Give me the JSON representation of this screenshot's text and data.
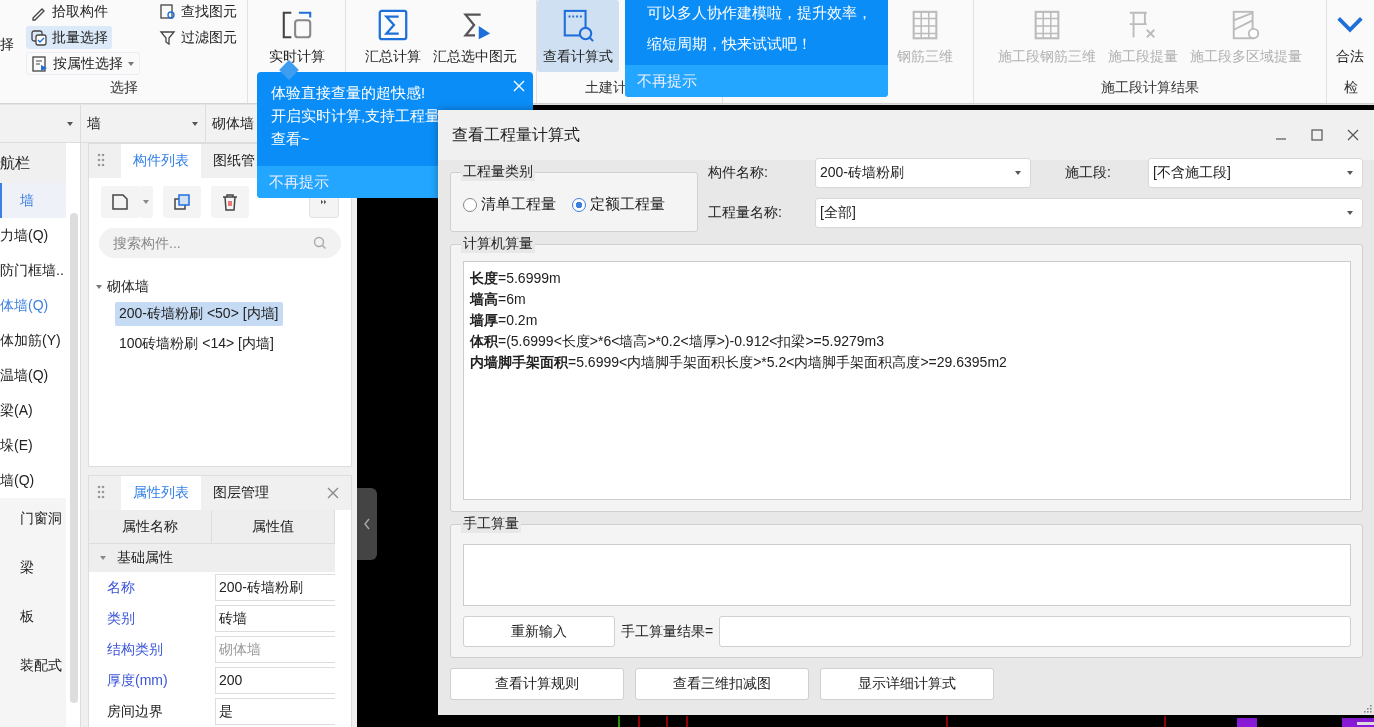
{
  "ribbon": {
    "partial_text": "择",
    "select_group": {
      "label": "选择",
      "columns": [
        [
          {
            "kind": "pick",
            "label": "拾取构件",
            "selected": false,
            "dropdown": false
          },
          {
            "kind": "batch",
            "label": "批量选择",
            "selected": true,
            "dropdown": false
          },
          {
            "kind": "attr",
            "label": "按属性选择",
            "selected": false,
            "dropdown": true
          }
        ],
        [
          {
            "kind": "find",
            "label": "查找图元",
            "selected": false,
            "dropdown": false
          },
          {
            "kind": "filter",
            "label": "过滤图元",
            "selected": false,
            "dropdown": false
          }
        ]
      ]
    },
    "groups": [
      {
        "buttons": [
          {
            "kind": "realtime",
            "label": "实时计算",
            "selected": false,
            "disabled": false
          }
        ]
      },
      {
        "buttons": [
          {
            "kind": "sum",
            "label": "汇总计算",
            "selected": false,
            "disabled": false
          },
          {
            "kind": "sumsel",
            "label": "汇总选中图元",
            "selected": false,
            "disabled": false
          }
        ]
      },
      {
        "label": "土建计",
        "buttons": [
          {
            "kind": "formula",
            "label": "查看计算式",
            "selected": true,
            "disabled": false
          }
        ]
      },
      {
        "buttons": [
          {
            "kind": "rebar",
            "label": "钢筋三维",
            "selected": false,
            "disabled": true
          }
        ]
      },
      {
        "label": "施工段计算结果",
        "buttons": [
          {
            "kind": "rebar",
            "label": "施工段钢筋三维",
            "selected": false,
            "disabled": true
          },
          {
            "kind": "fx",
            "label": "施工段提量",
            "selected": false,
            "disabled": true
          },
          {
            "kind": "zone",
            "label": "施工段多区域提量",
            "selected": false,
            "disabled": true
          }
        ]
      },
      {
        "label": "检",
        "buttons": [
          {
            "kind": "check",
            "label": "合法",
            "selected": false,
            "disabled": false
          }
        ]
      }
    ]
  },
  "tooltips": [
    {
      "lines": [
        "可以多人协作建模啦，提升效率，",
        "缩短周期，快来试试吧！"
      ],
      "dismiss": "不再提示",
      "closable": false
    },
    {
      "lines": [
        "体验直接查量的超快感!",
        "开启实时计算,支持工程量",
        "查看~"
      ],
      "dismiss": "不再提示",
      "closable": true
    }
  ],
  "filters": [
    {
      "value": "墙"
    },
    {
      "value": "砌体墙"
    }
  ],
  "nav": {
    "header": "航栏",
    "items": [
      {
        "label": "墙",
        "selected": true,
        "emphasized": true
      },
      {
        "label": "力墙(Q)",
        "selected": false,
        "emphasized": false
      },
      {
        "label": "防门框墙..",
        "selected": false,
        "emphasized": false
      },
      {
        "label": "体墙(Q)",
        "selected": false,
        "emphasized": true
      },
      {
        "label": "体加筋(Y)",
        "selected": false,
        "emphasized": false
      },
      {
        "label": "温墙(Q)",
        "selected": false,
        "emphasized": false
      },
      {
        "label": "梁(A)",
        "selected": false,
        "emphasized": false
      },
      {
        "label": "垛(E)",
        "selected": false,
        "emphasized": false
      },
      {
        "label": "墙(Q)",
        "selected": false,
        "emphasized": false
      }
    ],
    "categories": [
      {
        "label": "门窗洞"
      },
      {
        "label": "梁"
      },
      {
        "label": "板"
      },
      {
        "label": "装配式"
      }
    ]
  },
  "component_panel": {
    "tabs": [
      {
        "label": "构件列表",
        "selected": true
      },
      {
        "label": "图纸管",
        "selected": false
      }
    ],
    "search": {
      "placeholder": "搜索构件..."
    },
    "tree": [
      {
        "label": "砌体墙",
        "expanded": true,
        "children": [
          {
            "label": "200-砖墙粉刷 <50> [内墙]",
            "selected": true
          },
          {
            "label": "100砖墙粉刷 <14> [内墙]",
            "selected": false
          }
        ]
      }
    ]
  },
  "property_panel": {
    "tabs": [
      {
        "label": "属性列表",
        "selected": true
      },
      {
        "label": "图层管理",
        "selected": false
      }
    ],
    "columns": [
      "属性名称",
      "属性值"
    ],
    "groups": [
      {
        "label": "基础属性",
        "expanded": true,
        "rows": [
          {
            "name": "名称",
            "value": "200-砖墙粉刷",
            "public": true,
            "disabled": false
          },
          {
            "name": "类别",
            "value": "砖墙",
            "public": true,
            "disabled": false
          },
          {
            "name": "结构类别",
            "value": "砌体墙",
            "public": true,
            "disabled": true
          },
          {
            "name": "厚度(mm)",
            "value": "200",
            "public": true,
            "disabled": false
          },
          {
            "name": "房间边界",
            "value": "是",
            "public": false,
            "disabled": false
          }
        ]
      }
    ]
  },
  "dialog": {
    "title": "查看工程量计算式",
    "quantity_type": {
      "label": "工程量类别",
      "options": [
        {
          "label": "清单工程量",
          "selected": false
        },
        {
          "label": "定额工程量",
          "selected": true
        }
      ]
    },
    "fields": [
      {
        "label": "构件名称:",
        "value": "200-砖墙粉刷"
      },
      {
        "label": "施工段:",
        "value": "[不含施工段]"
      },
      {
        "label": "工程量名称:",
        "value": "[全部]"
      }
    ],
    "computer": {
      "label": "计算机算量",
      "lines": [
        "**长度**=5.6999m",
        "**墙高**=6m",
        "**墙厚**=0.2m",
        "**体积**=(5.6999<长度>*6<墙高>*0.2<墙厚>)-0.912<扣梁>=5.9279m3",
        "**内墙脚手架面积**=5.6999<内墙脚手架面积长度>*5.2<内墙脚手架面积高度>=29.6395m2"
      ]
    },
    "manual": {
      "label": "手工算量",
      "reenter_button": "重新输入",
      "result_label": "手工算量结果="
    },
    "buttons": [
      "查看计算规则",
      "查看三维扣减图",
      "显示详细计算式"
    ]
  }
}
